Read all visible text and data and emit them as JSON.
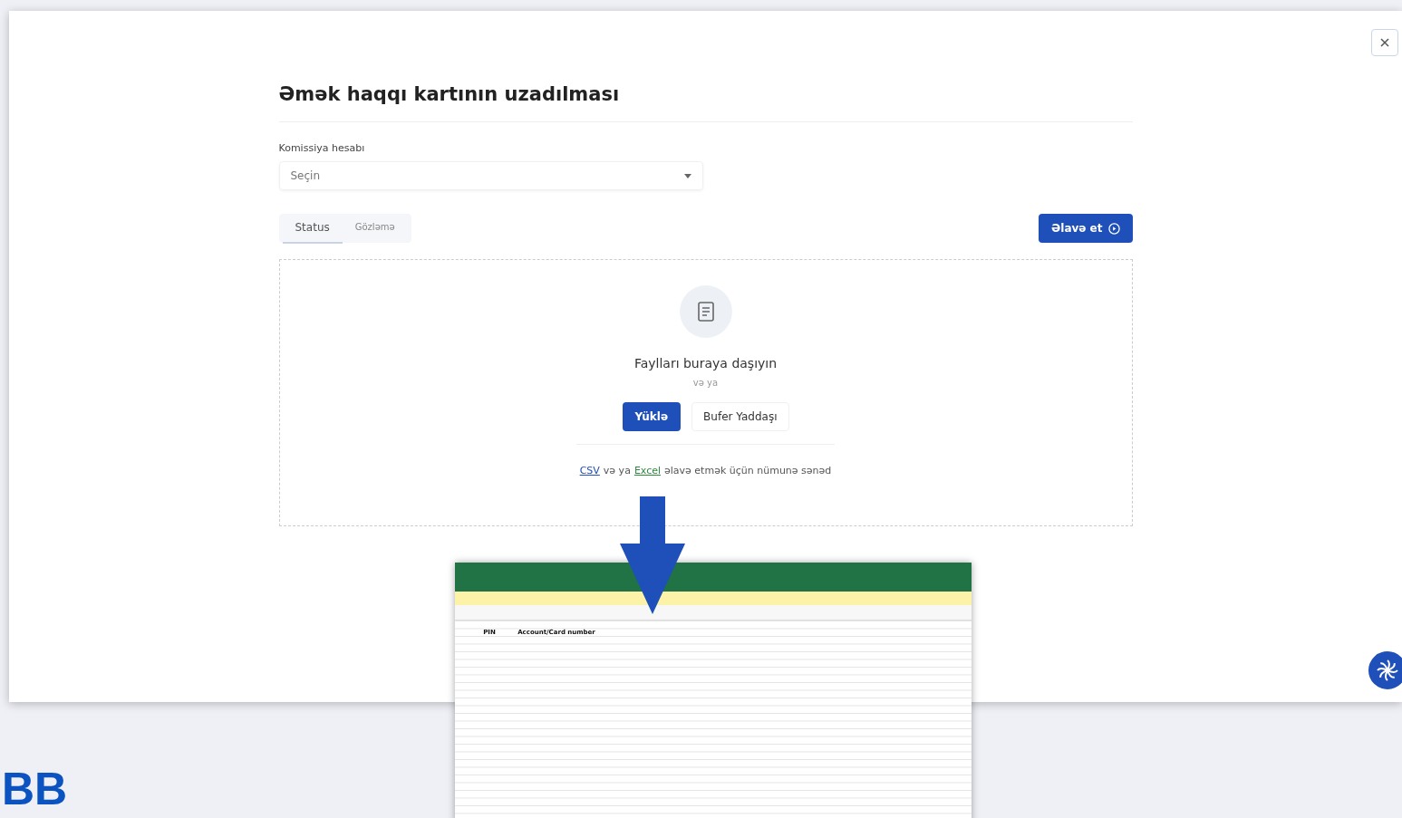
{
  "dialog": {
    "title": "Əmək haqqı kartının uzadılması",
    "field": {
      "label": "Komissiya hesabı",
      "placeholder": "Seçin"
    },
    "tabs": [
      {
        "label": "Status",
        "selected": true
      },
      {
        "label": "Gözləmə",
        "selected": false
      }
    ],
    "add_button": "Əlavə et",
    "dropzone": {
      "heading": "Faylları buraya daşıyın",
      "or": "və ya",
      "upload_button": "Yüklə",
      "clipboard_button": "Bufer Yaddaşı",
      "sample_note": {
        "csv": "CSV",
        "mid": "və ya",
        "excel": "Excel",
        "rest": "əlavə etmək üçün nümunə sənəd"
      }
    }
  },
  "spreadsheet": {
    "headers": [
      "PIN",
      "Account/Card number"
    ]
  },
  "logo": "BB"
}
